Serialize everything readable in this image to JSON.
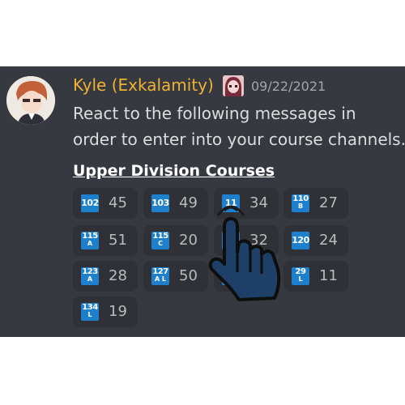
{
  "message": {
    "username": "Kyle (Exkalamity)",
    "timestamp": "09/22/2021",
    "line1": "React to the following messages in",
    "line2": "order to enter into your course channels.",
    "heading": "Upper Division Courses"
  },
  "reactions": [
    {
      "code": "102",
      "sub": "",
      "count": "45"
    },
    {
      "code": "103",
      "sub": "",
      "count": "49"
    },
    {
      "code": "11",
      "sub": "",
      "count": "34"
    },
    {
      "code": "110",
      "sub": "B",
      "count": "27"
    },
    {
      "code": "115",
      "sub": "A",
      "count": "51"
    },
    {
      "code": "115",
      "sub": "C",
      "count": "20"
    },
    {
      "code": "11",
      "sub": "A",
      "count": "32"
    },
    {
      "code": "120",
      "sub": "",
      "count": "24"
    },
    {
      "code": "123",
      "sub": "A",
      "count": "28"
    },
    {
      "code": "127",
      "sub": "A L",
      "count": "50"
    },
    {
      "code": "",
      "sub": "",
      "count": ""
    },
    {
      "code": "29",
      "sub": "L",
      "count": "11"
    },
    {
      "code": "134",
      "sub": "L",
      "count": "19"
    }
  ],
  "colors": {
    "username": "#f0b232",
    "emoji_bg": "#1e7fcc",
    "panel_bg": "#36393f",
    "hand_fill": "#1d3f68"
  },
  "icons": [
    "avatar",
    "user-badge-icon",
    "pointing-hand-icon"
  ]
}
